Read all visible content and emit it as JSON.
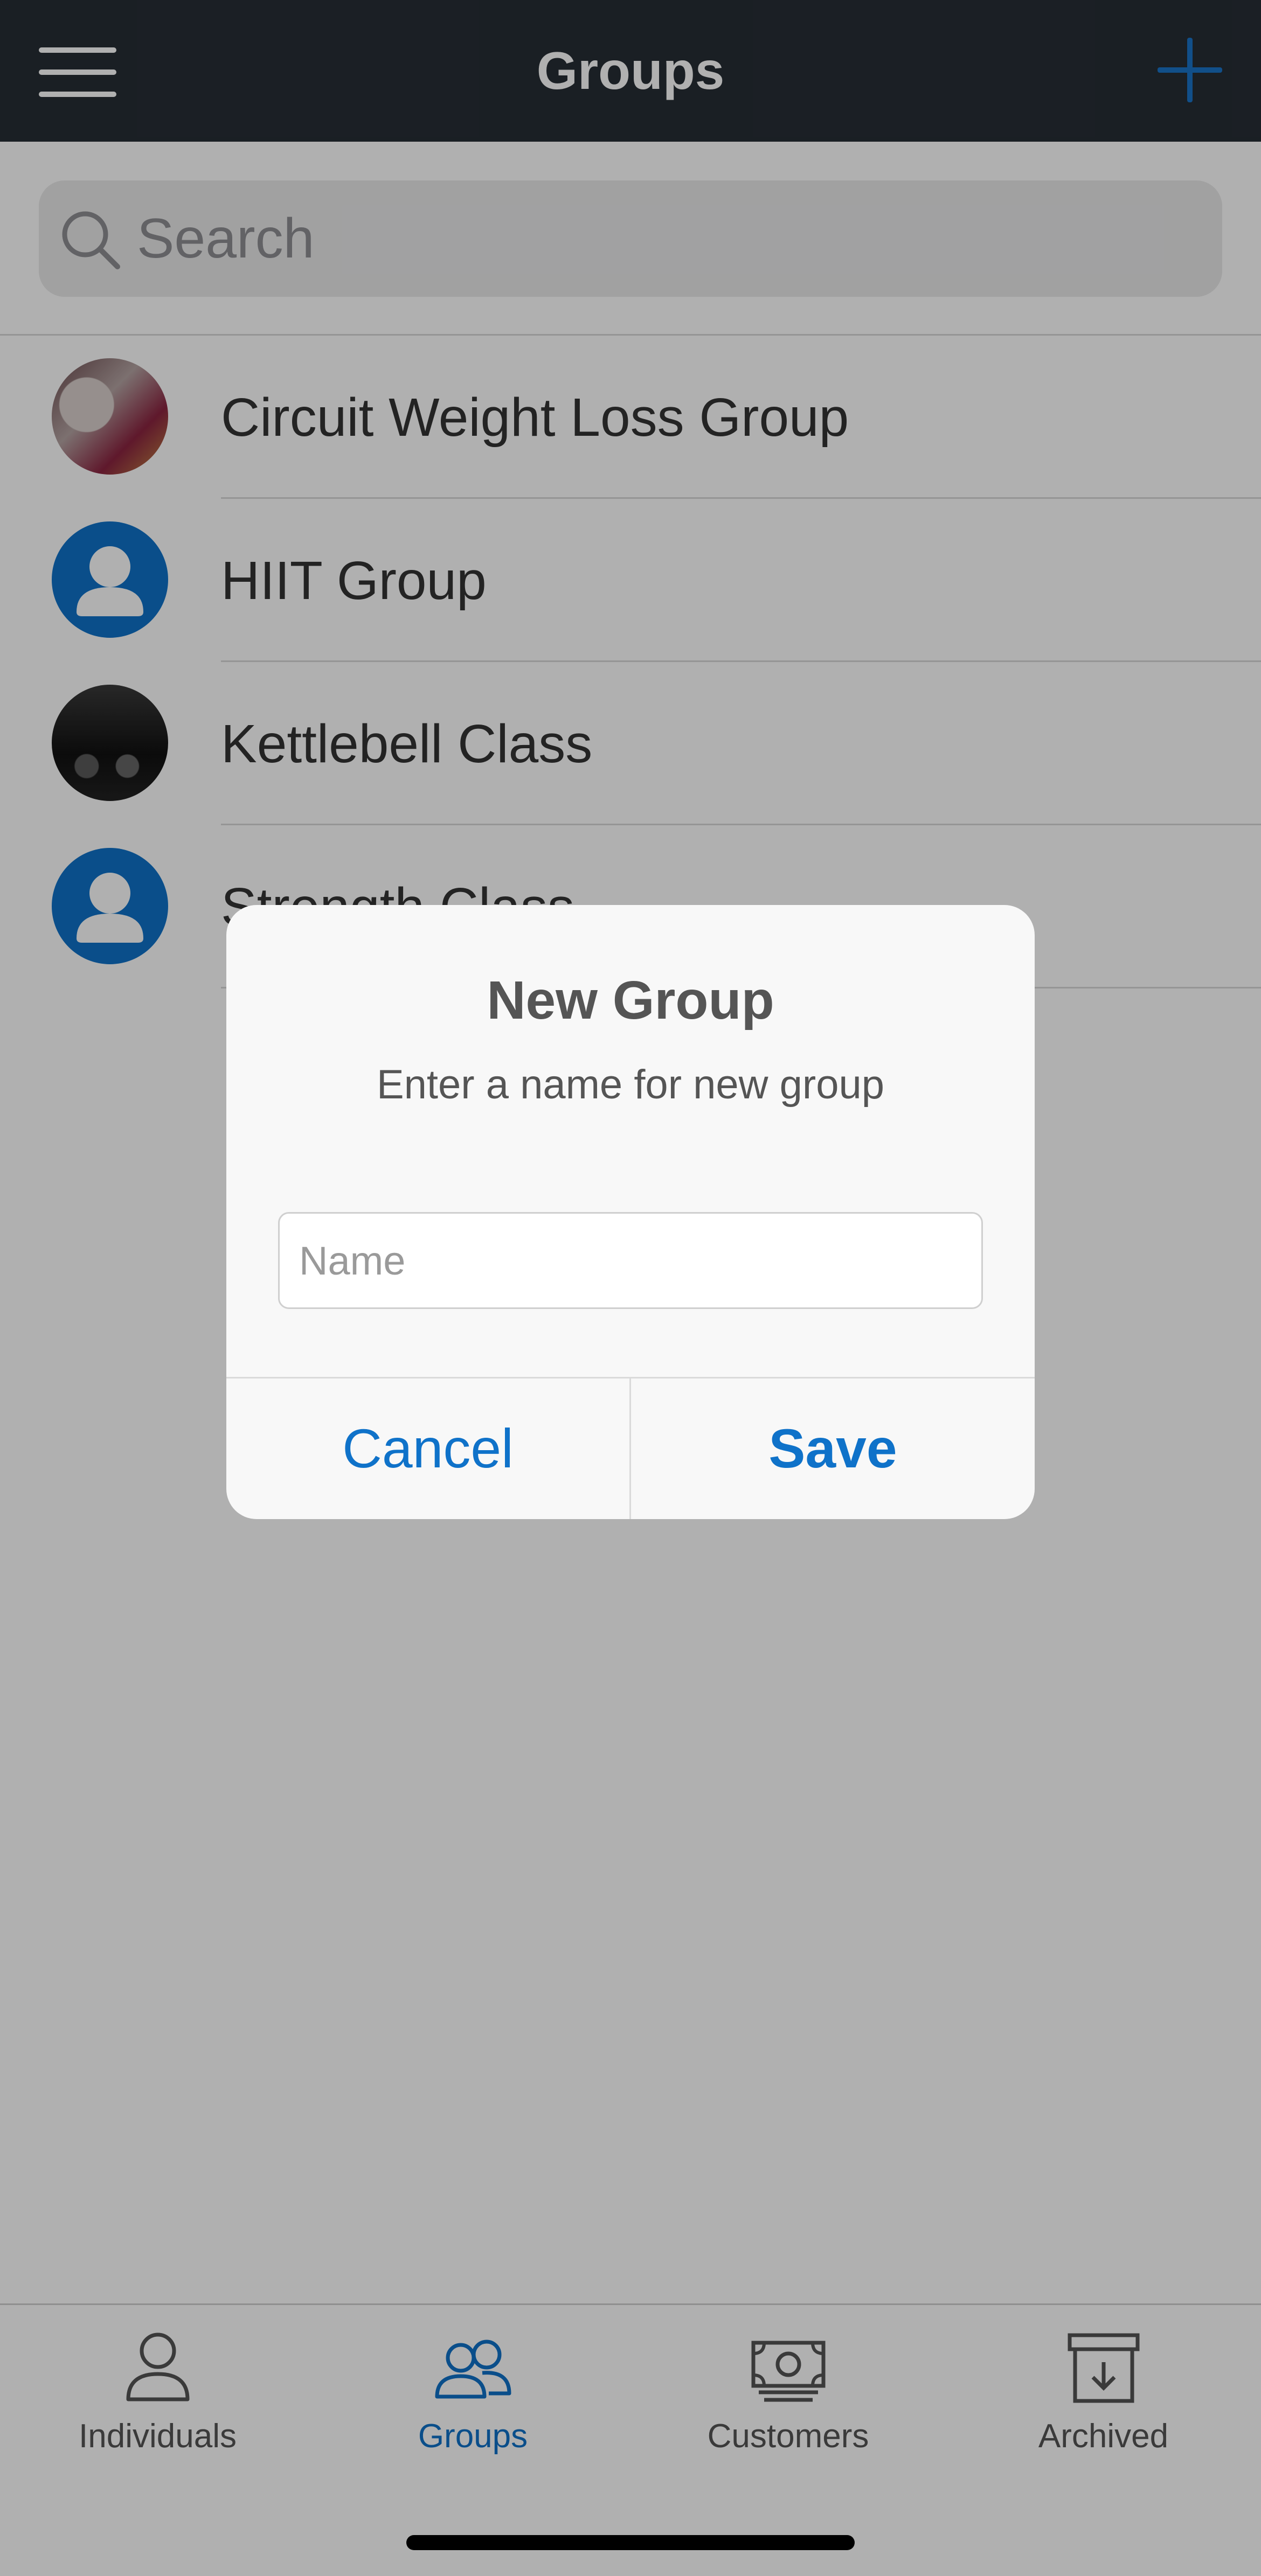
{
  "header": {
    "title": "Groups",
    "menu_icon": "hamburger-menu-icon",
    "add_icon": "plus-icon"
  },
  "search": {
    "placeholder": "Search",
    "icon": "search-icon"
  },
  "groups": [
    {
      "name": "Circuit Weight Loss Group",
      "avatar": "photo"
    },
    {
      "name": "HIIT Group",
      "avatar": "default-person"
    },
    {
      "name": "Kettlebell Class",
      "avatar": "photo"
    },
    {
      "name": "Strength Class",
      "avatar": "default-person"
    }
  ],
  "dialog": {
    "title": "New Group",
    "message": "Enter a name for new group",
    "input_placeholder": "Name",
    "input_value": "",
    "cancel_label": "Cancel",
    "save_label": "Save"
  },
  "tabs": [
    {
      "label": "Individuals",
      "icon": "person-icon",
      "active": false
    },
    {
      "label": "Groups",
      "icon": "people-icon",
      "active": true
    },
    {
      "label": "Customers",
      "icon": "money-icon",
      "active": false
    },
    {
      "label": "Archived",
      "icon": "archive-box-icon",
      "active": false
    }
  ],
  "colors": {
    "header_bg": "#272d35",
    "accent": "#0f72c9",
    "overlay": "rgba(0,0,0,0.31)"
  }
}
